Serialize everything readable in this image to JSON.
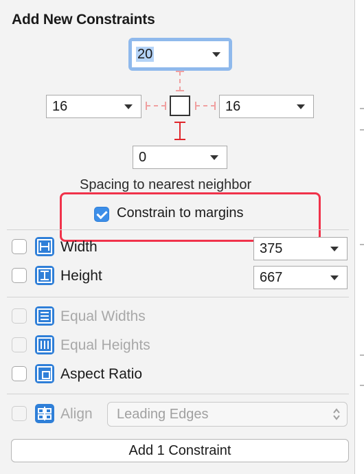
{
  "title": "Add New Constraints",
  "spacing": {
    "top": "20",
    "left": "16",
    "right": "16",
    "bottom": "0",
    "caption": "Spacing to nearest neighbor"
  },
  "constrain_to_margins": {
    "label": "Constrain to margins",
    "checked": true
  },
  "size_rows": [
    {
      "label": "Width",
      "value": "375",
      "checked": false,
      "icon": "width-icon"
    },
    {
      "label": "Height",
      "value": "667",
      "checked": false,
      "icon": "height-icon"
    }
  ],
  "relation_rows": [
    {
      "label": "Equal Widths",
      "enabled": false,
      "icon": "equal-widths-icon"
    },
    {
      "label": "Equal Heights",
      "enabled": false,
      "icon": "equal-heights-icon"
    },
    {
      "label": "Aspect Ratio",
      "enabled": true,
      "icon": "aspect-ratio-icon"
    }
  ],
  "align": {
    "label": "Align",
    "option": "Leading Edges",
    "enabled": false,
    "icon": "align-icon"
  },
  "add_button": "Add 1 Constraint",
  "colors": {
    "accent": "#3c8ee8",
    "highlight_border": "#f0324a",
    "constraint_red": "#e0262b",
    "dashed_pink": "#f0a0a0"
  }
}
